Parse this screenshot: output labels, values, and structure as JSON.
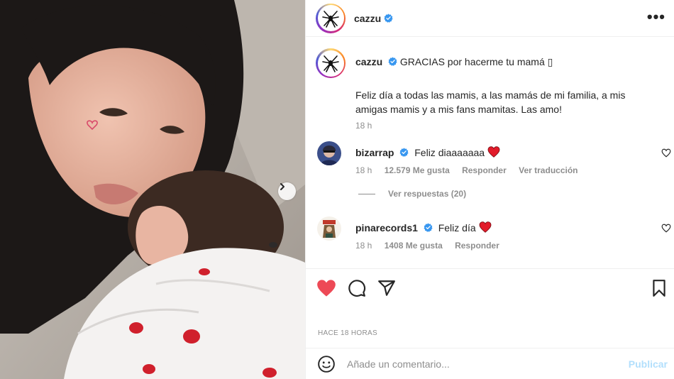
{
  "post": {
    "author": "cazzu",
    "more_label": "•••",
    "caption_text": "GRACIAS por hacerme tu mamá ▯",
    "caption_body": "Feliz día a todas las mamis, a las mamás de mi familia, a mis amigas mamis y a mis fans mamitas. Las amo!",
    "caption_time": "18 h",
    "timestamp": "HACE 18 HORAS"
  },
  "comments": [
    {
      "user": "bizarrap",
      "text": "Feliz diaaaaaaa",
      "time": "18 h",
      "likes": "12.579 Me gusta",
      "reply": "Responder",
      "translate": "Ver traducción"
    },
    {
      "user": "pinarecords1",
      "text": "Feliz día",
      "time": "18 h",
      "likes": "1408 Me gusta",
      "reply": "Responder"
    }
  ],
  "replies_link": "Ver respuestas (20)",
  "composer": {
    "placeholder": "Añade un comentario...",
    "publish": "Publicar"
  },
  "colors": {
    "like_red": "#ed4956",
    "verified_blue": "#3897f0",
    "publish_disabled": "#b2dffc"
  }
}
